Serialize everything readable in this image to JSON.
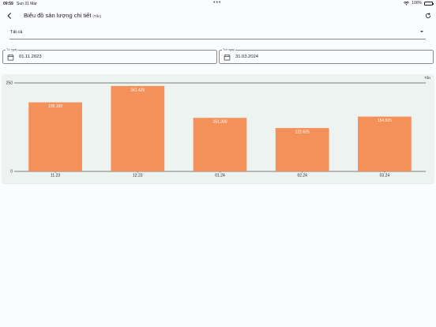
{
  "status_bar": {
    "time": "09:59",
    "date": "Sun 31 Mar",
    "battery": "100%"
  },
  "header": {
    "title": "Biểu đồ sản lượng chi tiết",
    "unit": "(Tấn)"
  },
  "filter": {
    "selected": "Tất cả"
  },
  "from_date": {
    "label": "Từ ngày",
    "value": "01.11.2023"
  },
  "to_date": {
    "label": "Tới ngày",
    "value": "31.03.2024"
  },
  "chart_data": {
    "type": "bar",
    "categories": [
      "11.23",
      "12.23",
      "01.24",
      "02.24",
      "03.24"
    ],
    "values": [
      195.1,
      241.425,
      151.3,
      122.625,
      154.915
    ],
    "value_labels": [
      "195.100",
      "241.425",
      "151.300",
      "122.625",
      "154.915"
    ],
    "y_ticks": [
      "0",
      "250"
    ],
    "ylim": [
      0,
      250
    ],
    "unit": "Tấn",
    "bar_color": "#f4915a",
    "grid": false
  },
  "colors": {
    "background": "#fbfcfe",
    "card": "#edf3f1",
    "bar": "#f4915a"
  },
  "icons": {
    "back": "chevron-left-icon",
    "refresh": "refresh-icon",
    "calendar": "calendar-icon",
    "dropdown": "caret-down-icon"
  }
}
